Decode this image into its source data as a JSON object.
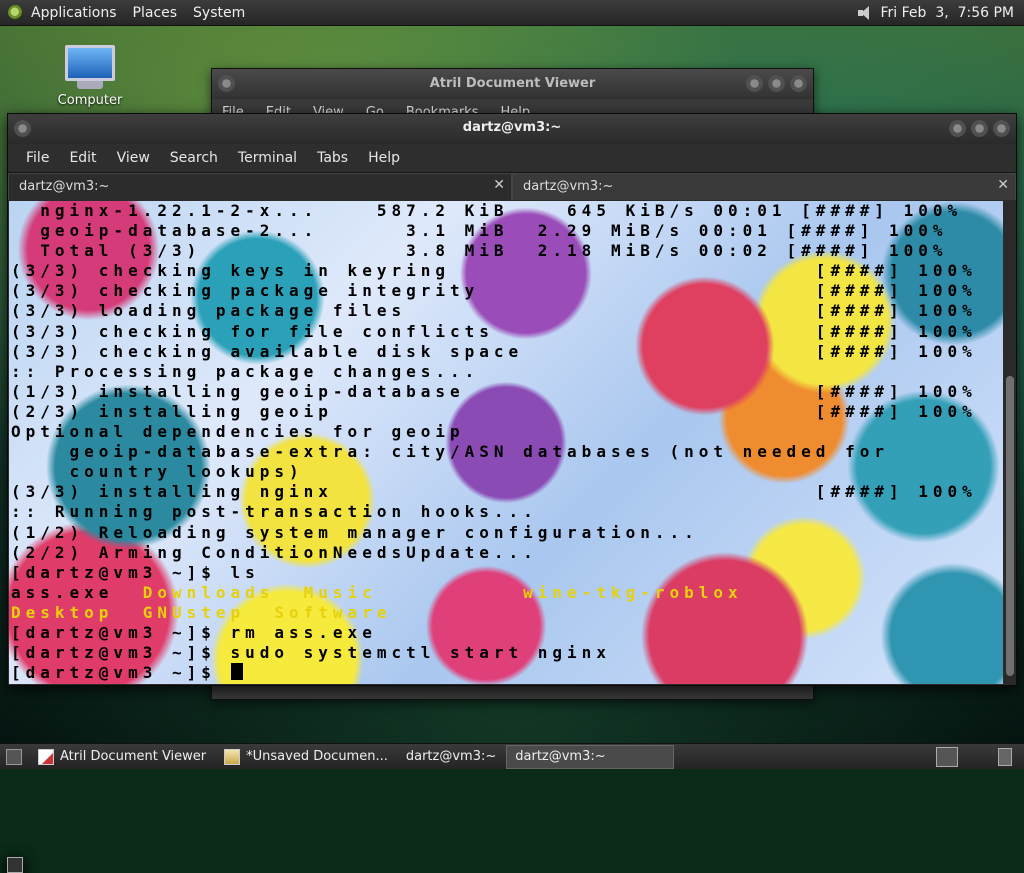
{
  "top_panel": {
    "menus": [
      "Applications",
      "Places",
      "System"
    ],
    "clock": "Fri Feb  3,  7:56 PM"
  },
  "desktop": {
    "icons": [
      {
        "label": "Computer"
      }
    ]
  },
  "atril_window": {
    "title": "Atril Document Viewer",
    "menus": [
      "File",
      "Edit",
      "View",
      "Go",
      "Bookmarks",
      "Help"
    ]
  },
  "terminal_window": {
    "title": "dartz@vm3:~",
    "menus": [
      "File",
      "Edit",
      "View",
      "Search",
      "Terminal",
      "Tabs",
      "Help"
    ],
    "tabs": [
      {
        "label": "dartz@vm3:~"
      },
      {
        "label": "dartz@vm3:~"
      }
    ],
    "lines": [
      "  nginx-1.22.1-2-x...    587.2 KiB    645 KiB/s 00:01 [####] 100%",
      "  geoip-database-2...      3.1 MiB  2.29 MiB/s 00:01 [####] 100%",
      "  Total (3/3)              3.8 MiB  2.18 MiB/s 00:02 [####] 100%",
      "(3/3) checking keys in keyring                         [####] 100%",
      "(3/3) checking package integrity                       [####] 100%",
      "(3/3) loading package files                            [####] 100%",
      "(3/3) checking for file conflicts                      [####] 100%",
      "(3/3) checking available disk space                    [####] 100%",
      ":: Processing package changes...",
      "(1/3) installing geoip-database                        [####] 100%",
      "(2/3) installing geoip                                 [####] 100%",
      "Optional dependencies for geoip",
      "    geoip-database-extra: city/ASN databases (not needed for",
      "    country lookups)",
      "(3/3) installing nginx                                 [####] 100%",
      ":: Running post-transaction hooks...",
      "(1/2) Reloading system manager configuration...",
      "(2/2) Arming ConditionNeedsUpdate...",
      "[dartz@vm3 ~]$ ls"
    ],
    "ls_output": {
      "row1_plain": "ass.exe",
      "row1_dirs": "  Downloads  Music          wine-tkg-roblox",
      "row2_dirs": "Desktop  GNUstep  Software"
    },
    "after_lines": [
      "[dartz@vm3 ~]$ rm ass.exe",
      "[dartz@vm3 ~]$ sudo systemctl start nginx"
    ],
    "prompt": "[dartz@vm3 ~]$ "
  },
  "taskbar": {
    "items": [
      {
        "label": "Atril Document Viewer",
        "icon": "document-icon"
      },
      {
        "label": "*Unsaved Documen...",
        "icon": "text-editor-icon"
      },
      {
        "label": "dartz@vm3:~",
        "icon": "terminal-icon"
      },
      {
        "label": "dartz@vm3:~",
        "icon": "terminal-icon",
        "active": true
      }
    ]
  },
  "colors": {
    "directory_text": "#e6d10a",
    "terminal_text": "#000000"
  }
}
